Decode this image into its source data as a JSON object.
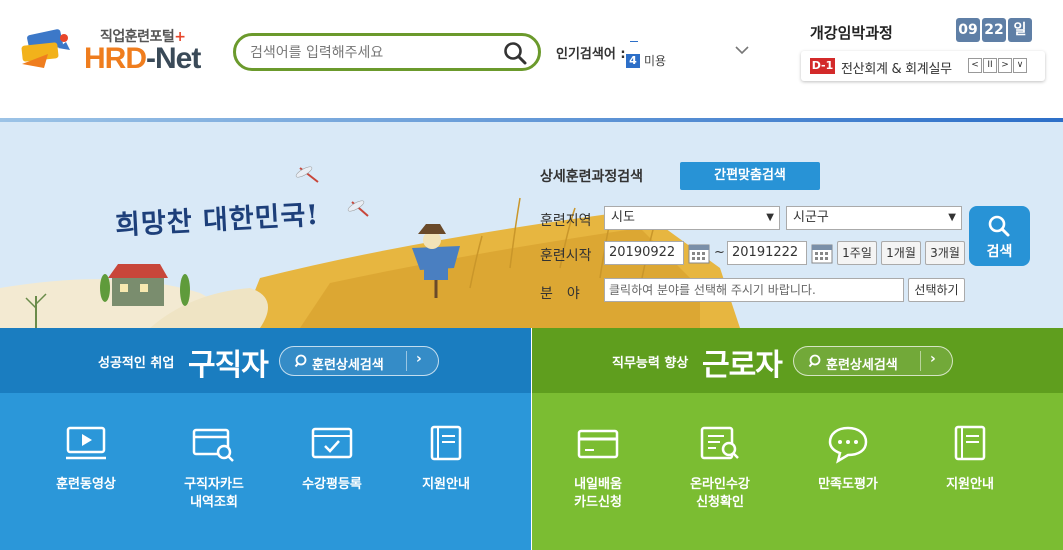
{
  "header": {
    "logo_subtitle": "직업훈련포털",
    "logo_plus": "+",
    "logo_brand_a": "HRD",
    "logo_brand_b": "-Net",
    "search_placeholder": "검색어를 입력해주세요",
    "popular_label": "인기검색어 :",
    "popular_rank": "4",
    "popular_word": "미용",
    "opening": {
      "title": "개강임박과정",
      "month": "09",
      "day": "22",
      "day_unit": "일",
      "d_badge": "D-1",
      "course": "전산회계 & 회계실무",
      "controls": [
        "<",
        "II",
        ">",
        "∨"
      ]
    }
  },
  "hero": {
    "slogan": "희망찬 대한민국!",
    "search_title": "상세훈련과정검색",
    "quick_search": "간편맞춤검색",
    "region_label": "훈련지역",
    "region_city": "시도",
    "region_district": "시군구",
    "start_label": "훈련시작",
    "start_date": "20190922",
    "tilde": "~",
    "end_date": "20191222",
    "periods": [
      "1주일",
      "1개월",
      "3개월"
    ],
    "field_label": "분　야",
    "field_placeholder": "클릭하여 분야를 선택해 주시기 바랍니다.",
    "select_button": "선택하기",
    "search_button": "검색"
  },
  "jobseeker": {
    "tag": "성공적인 취업",
    "title": "구직자",
    "detail": "훈련상세검색",
    "menu": [
      "훈련동영상",
      "구직자카드\n내역조회",
      "수강평등록",
      "지원안내"
    ]
  },
  "worker": {
    "tag": "직무능력 향상",
    "title": "근로자",
    "detail": "훈련상세검색",
    "menu": [
      "내일배움\n카드신청",
      "온라인수강\n신청확인",
      "만족도평가",
      "지원안내"
    ]
  },
  "colors": {
    "brand_orange": "#ef7d1e",
    "search_border": "#6b9a2c",
    "accent_blue": "#2893d6",
    "jobseeker_blue": "#2b97d9",
    "worker_green": "#7bbd32"
  }
}
